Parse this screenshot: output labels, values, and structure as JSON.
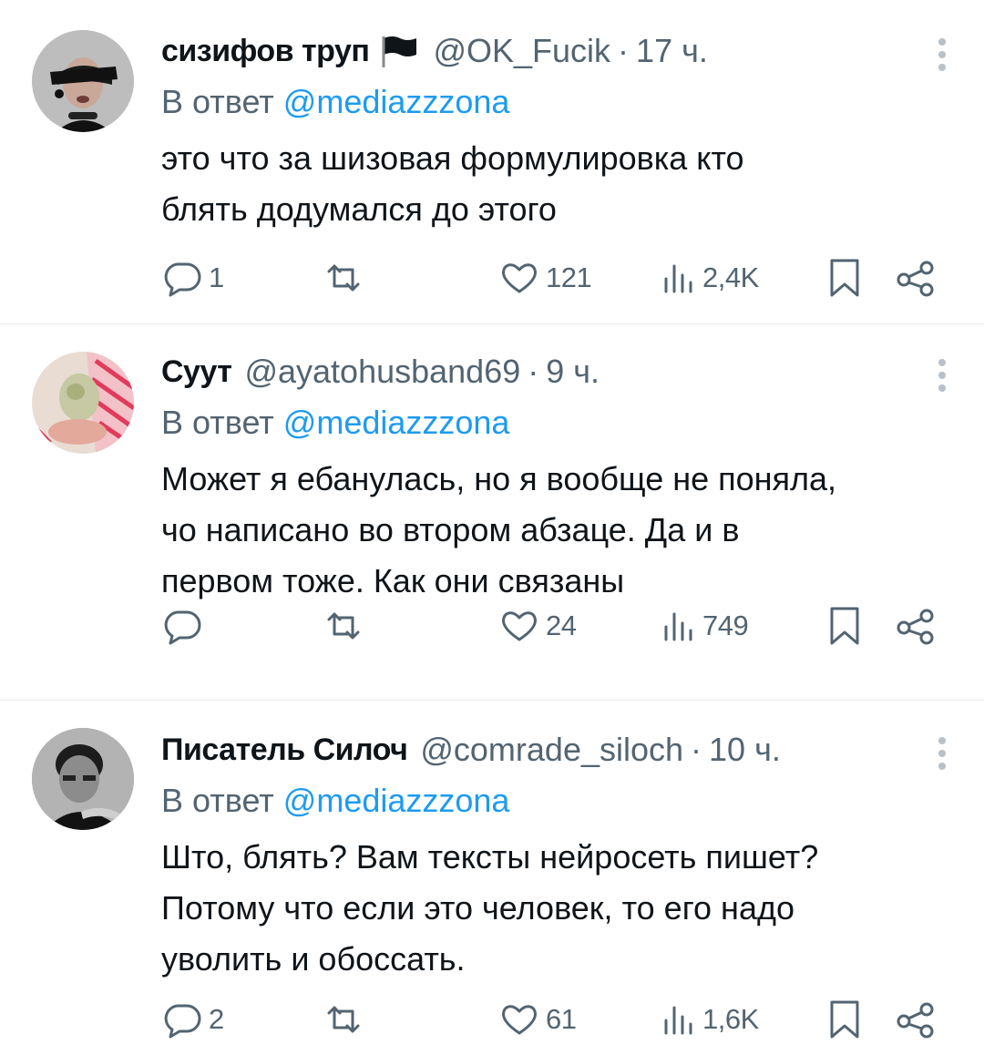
{
  "tweets": [
    {
      "name": "сизифов труп",
      "handle": "@OK_Fucik",
      "dot": "·",
      "time": "17 ч.",
      "reply_prefix": "В ответ",
      "reply_to": "@mediazzzona",
      "lines": [
        "это что за шизовая формулировка кто",
        "блять додумался до этого"
      ],
      "replies": "1",
      "retweets": "",
      "likes": "121",
      "views": "2,4K"
    },
    {
      "name": "Суут",
      "handle": "@ayatohusband69",
      "dot": "·",
      "time": "9 ч.",
      "reply_prefix": "В ответ",
      "reply_to": "@mediazzzona",
      "lines": [
        "Может я ебанулась, но я вообще не поняла,",
        "чо написано во втором абзаце. Да и в",
        "первом тоже. Как они связаны"
      ],
      "replies": "",
      "retweets": "",
      "likes": "24",
      "views": "749"
    },
    {
      "name": "Писатель Силоч",
      "handle": "@comrade_siloch",
      "dot": "·",
      "time": "10 ч.",
      "reply_prefix": "В ответ",
      "reply_to": "@mediazzzona",
      "lines": [
        "Што, блять? Вам тексты нейросеть пишет?",
        "Потому что если это человек, то его надо",
        "уволить и обоссать."
      ],
      "replies": "2",
      "retweets": "",
      "likes": "61",
      "views": "1,6K"
    }
  ],
  "icons": {
    "more": "more-vertical-icon",
    "reply": "reply-bubble-icon",
    "retweet": "retweet-icon",
    "like": "heart-icon",
    "views": "views-chart-icon",
    "bookmark": "bookmark-icon",
    "share": "share-icon",
    "flag": "black-flag-icon"
  },
  "colors": {
    "text": "#0f1419",
    "secondary": "#536471",
    "mention": "#1d9bf0",
    "divider": "#e3e6e9"
  }
}
